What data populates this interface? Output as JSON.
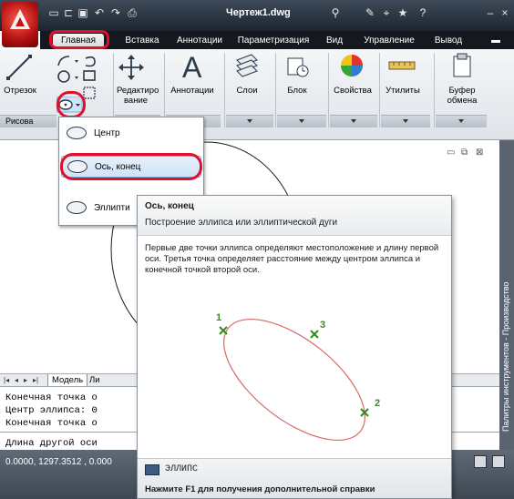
{
  "window": {
    "title": "Чертеж1.dwg"
  },
  "tabs": [
    "Главная",
    "Вставка",
    "Аннотации",
    "Параметризация",
    "Вид",
    "Управление",
    "Вывод"
  ],
  "ribbon": {
    "line_tool": "Отрезок",
    "edit_tool": "Редактиро вание",
    "annotations_tool": "Аннотации",
    "layers_tool": "Слои",
    "block_tool": "Блок",
    "properties_tool": "Свойства",
    "utilities_tool": "Утилиты",
    "clipboard_tool": "Буфер обмена",
    "draw_group": "Рисова"
  },
  "dropdown": {
    "items": [
      "Центр",
      "Ось, конец",
      "Эллипти"
    ]
  },
  "layout_tabs": {
    "model": "Модель",
    "layout": "Ли"
  },
  "command_lines": [
    "Конечная точка о",
    "Центр эллипса: 0",
    "Конечная точка о",
    "Длина другой оси"
  ],
  "status": {
    "coords": "0.0000,   1297.3512 , 0.000"
  },
  "right_palette": {
    "title": "Палитры инструментов - Производство"
  },
  "tooltip": {
    "title": "Ось, конец",
    "subtitle": "Построение эллипса или эллиптической дуги",
    "description": "Первые две точки эллипса определяют местоположение и длину первой оси. Третья точка определяет расстояние между центром эллипса и конечной точкой второй оси.",
    "point1": "1",
    "point2": "2",
    "point3": "3",
    "command": "ЭЛЛИПС",
    "help": "Нажмите F1 для получения дополнительной справки"
  },
  "colors": {
    "highlight_ring": "#e0102a",
    "ellipse_stroke": "#d86a6a",
    "point_color": "#3a8a1a",
    "titlebar": "#1d2530"
  }
}
